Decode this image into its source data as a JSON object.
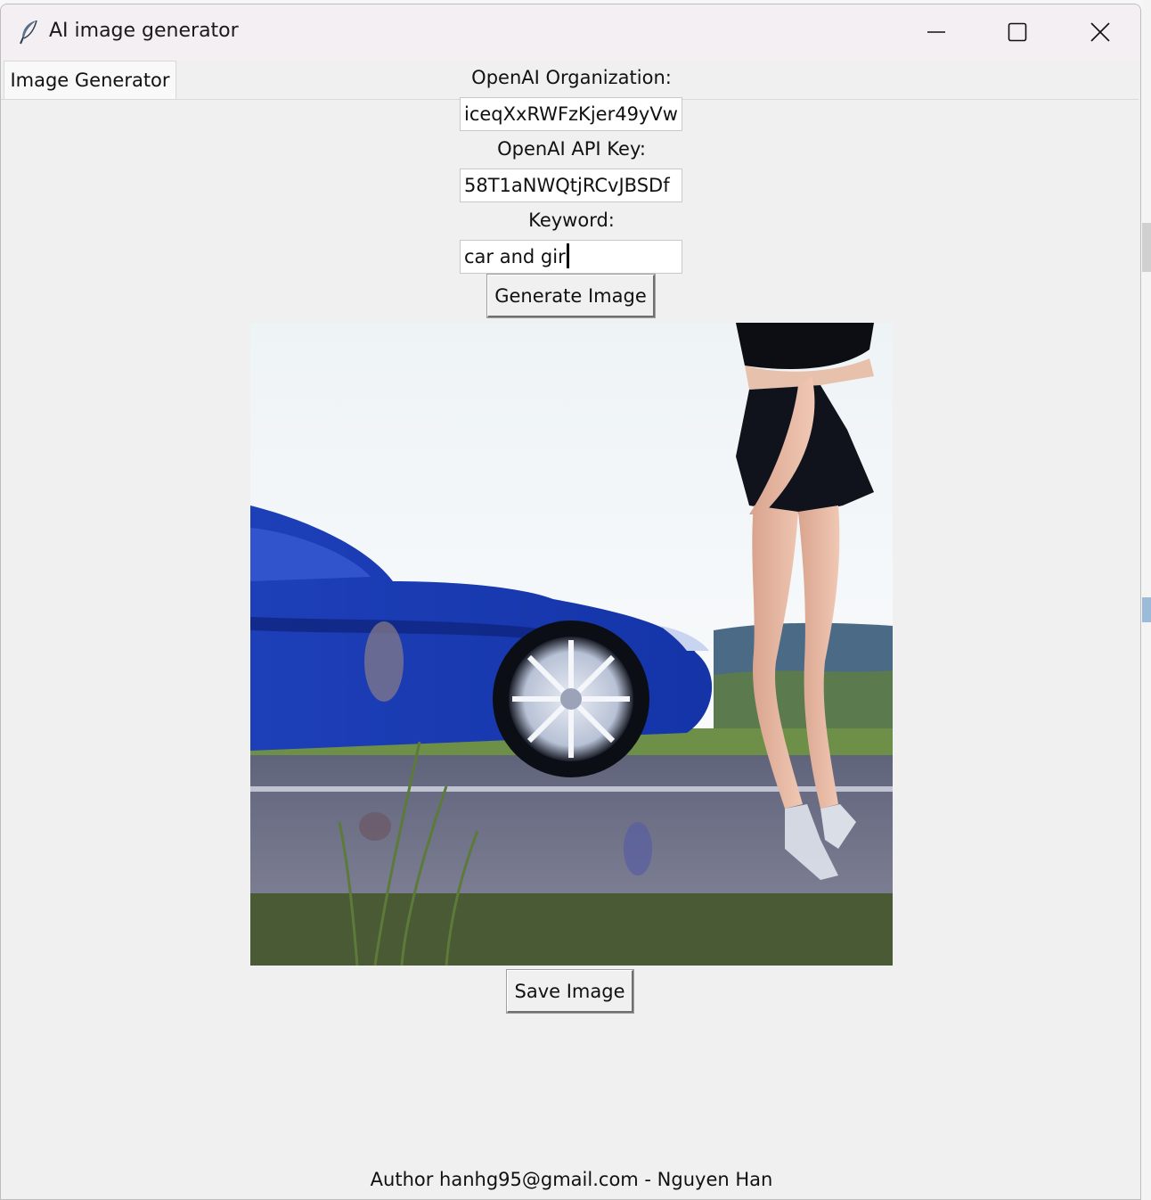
{
  "window": {
    "title": "AI image generator",
    "app_icon": "feather-icon",
    "controls": [
      "minimize-icon",
      "maximize-icon",
      "close-icon"
    ]
  },
  "tabs": [
    {
      "label": "Image Generator",
      "selected": true
    }
  ],
  "form": {
    "organization_label": "OpenAI Organization:",
    "organization_value": "iceqXxRWFzKjer49yVw",
    "api_key_label": "OpenAI API Key:",
    "api_key_value": "58T1aNWQtjRCvJBSDf",
    "keyword_label": "Keyword:",
    "keyword_value": "car and girl",
    "generate_button": "Generate Image"
  },
  "image": {
    "description_icon": "generated-image"
  },
  "save_button": "Save Image",
  "footer": "Author hanhg95@gmail.com - Nguyen Han"
}
